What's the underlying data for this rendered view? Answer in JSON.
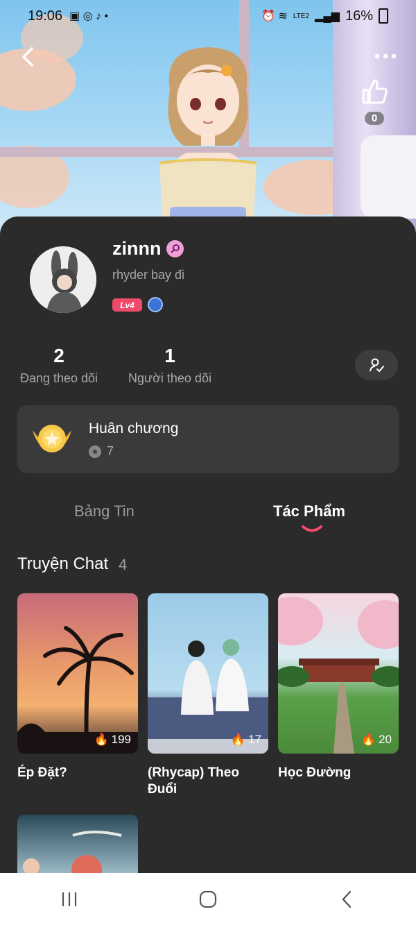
{
  "status_bar": {
    "time": "19:06",
    "battery": "16%",
    "network": "LTE2"
  },
  "header": {
    "like_count": "0",
    "icons": [
      "back-icon",
      "more-icon",
      "thumbs-up-icon"
    ]
  },
  "profile": {
    "name": "zinnn",
    "bio": "rhyder bay đi",
    "level": "Lv4",
    "gender_icon": "female-icon"
  },
  "stats": {
    "following": {
      "count": "2",
      "label": "Đang theo dõi"
    },
    "followers": {
      "count": "1",
      "label": "Người theo dõi"
    }
  },
  "medal": {
    "title": "Huân chương",
    "count": "7"
  },
  "tabs": {
    "feed": "Bảng Tin",
    "works": "Tác Phẩm",
    "active": "works"
  },
  "section": {
    "title": "Truyện Chat",
    "count": "4"
  },
  "stories": [
    {
      "title": "Ép Đặt?",
      "views": "199"
    },
    {
      "title": "(Rhycap) Theo Đuổi",
      "views": "17"
    },
    {
      "title": "Học Đường",
      "views": "20"
    },
    {
      "title": "",
      "views": ""
    }
  ],
  "colors": {
    "background": "#2b2b2b",
    "accent": "#ef4a6a",
    "card": "#3a3a3a"
  }
}
